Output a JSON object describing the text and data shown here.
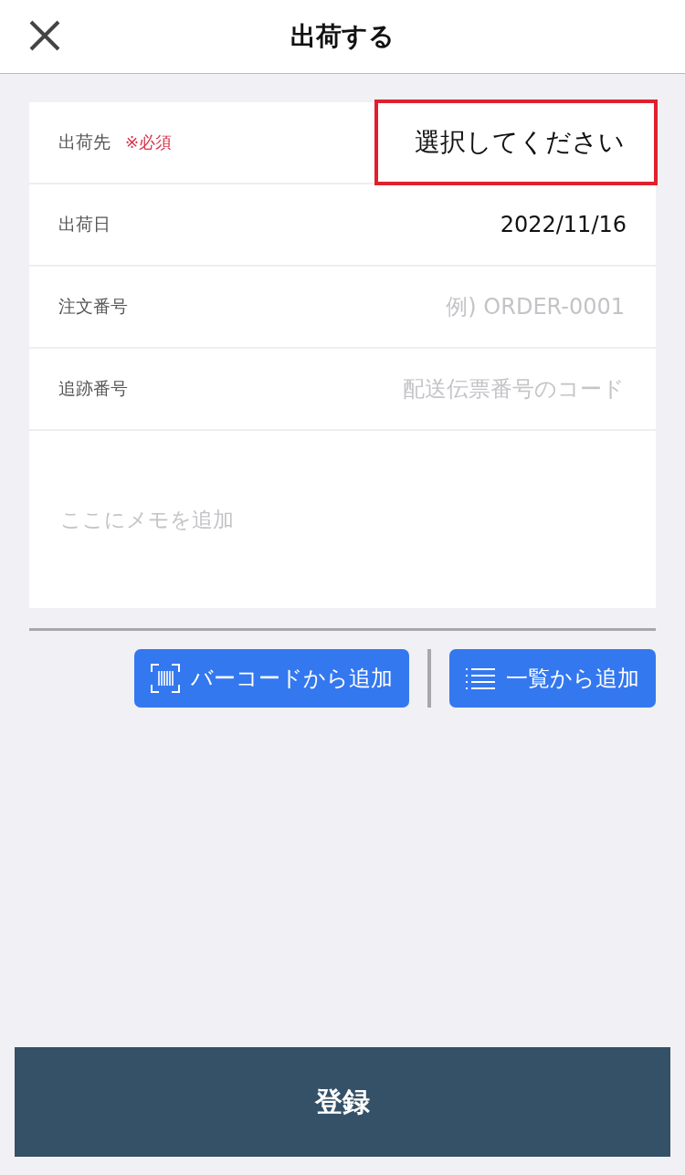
{
  "header": {
    "title": "出荷する"
  },
  "fields": [
    {
      "kind": "select",
      "label": "出荷先",
      "required_mark": "※必須",
      "value": "選択してください",
      "highlighted": true
    },
    {
      "kind": "value",
      "label": "出荷日",
      "value": "2022/11/16"
    },
    {
      "kind": "input",
      "label": "注文番号",
      "placeholder": "例) ORDER-0001"
    },
    {
      "kind": "input",
      "label": "追跡番号",
      "placeholder": "配送伝票番号のコード"
    }
  ],
  "memo": {
    "placeholder": "ここにメモを追加"
  },
  "add_buttons": [
    {
      "kind": "barcode",
      "label": "バーコードから追加"
    },
    {
      "kind": "list",
      "label": "一覧から追加"
    }
  ],
  "submit": {
    "label": "登録"
  }
}
